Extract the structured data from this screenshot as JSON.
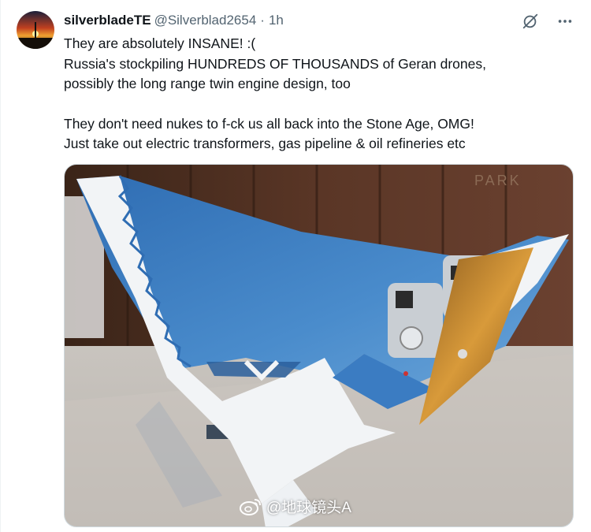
{
  "tweet": {
    "author": {
      "display_name": "silverbladeTE",
      "handle": "@Silverblad2654",
      "separator": "·",
      "time": "1h"
    },
    "text_lines": [
      "They are absolutely INSANE! :(",
      "Russia's stockpiling HUNDREDS OF THOUSANDS of Geran drones,",
      "possibly the long range twin engine design, too",
      "They don't need nukes to f-ck us all back into the Stone Age, OMG!",
      "Just take out electric transformers, gas pipeline & oil refineries etc"
    ],
    "media": {
      "watermark_text": "@地球镜头A",
      "background_sign_text": "PARK"
    },
    "icons": {
      "grok": "grok-icon",
      "more": "more-icon",
      "watermark_logo": "weibo-logo-icon"
    }
  },
  "colors": {
    "text_primary": "#0f1419",
    "text_secondary": "#536471",
    "border": "#cfd9de",
    "drone_blue": "#3f7fc0",
    "drone_white": "#f2f4f6"
  }
}
